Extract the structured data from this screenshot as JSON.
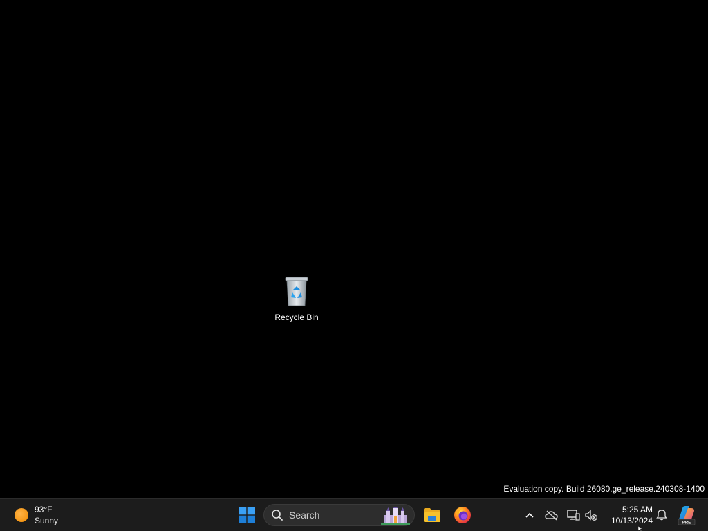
{
  "desktop": {
    "icons": [
      {
        "label": "Recycle Bin",
        "icon": "recycle-bin-icon"
      }
    ],
    "watermark": "Evaluation copy. Build 26080.ge_release.240308-1400"
  },
  "taskbar": {
    "weather": {
      "temperature": "93°F",
      "condition": "Sunny",
      "icon": "sun-icon"
    },
    "start": {
      "icon": "windows-logo-icon"
    },
    "search": {
      "placeholder": "Search",
      "icon": "search-icon"
    },
    "pinned_apps": [
      {
        "name": "File Explorer",
        "icon": "folder-icon"
      },
      {
        "name": "Firefox",
        "icon": "firefox-icon"
      }
    ],
    "tray": {
      "icons": [
        "chevron-up-icon",
        "onedrive-offline-icon",
        "network-disconnected-icon",
        "volume-muted-icon"
      ],
      "time": "5:25 AM",
      "date": "10/13/2024",
      "notification_icon": "bell-icon",
      "copilot_icon": "copilot-pre-icon"
    }
  },
  "colors": {
    "desktop_bg": "#000000",
    "taskbar_bg": "#1c1c1c",
    "windows_blue": "#1e90ff",
    "folder_yellow": "#f5c02b"
  }
}
